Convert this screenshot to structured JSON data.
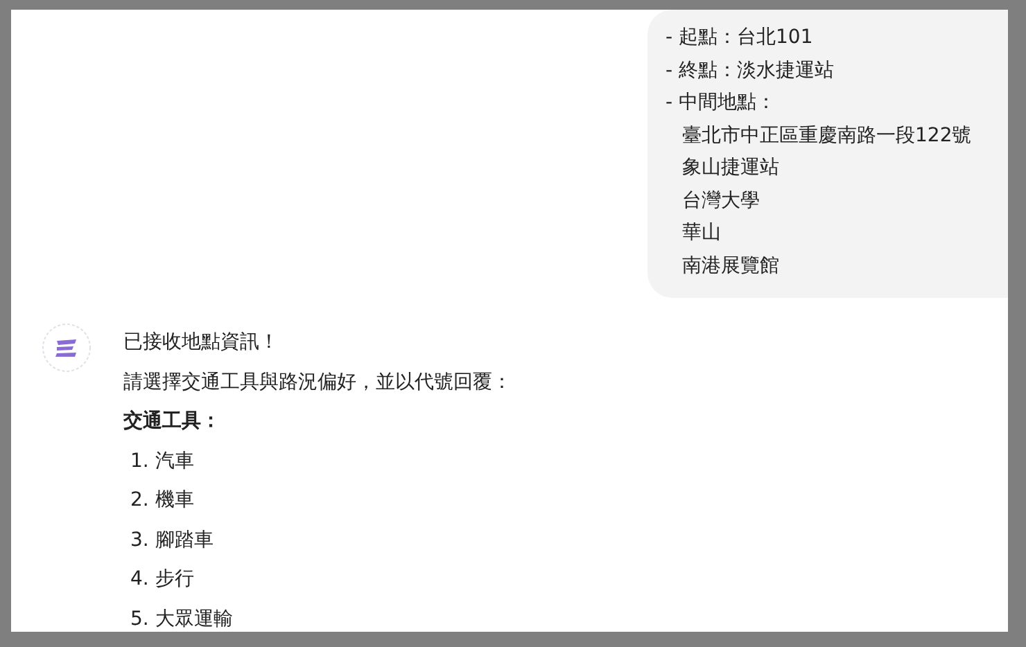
{
  "user_message": {
    "lines": [
      {
        "text": "- 起點：台北101",
        "kind": "bullet"
      },
      {
        "text": "- 終點：淡水捷運站",
        "kind": "bullet"
      },
      {
        "text": "- 中間地點：",
        "kind": "bullet"
      },
      {
        "text": "臺北市中正區重慶南路一段122號",
        "kind": "sub"
      },
      {
        "text": "象山捷運站",
        "kind": "sub"
      },
      {
        "text": "台灣大學",
        "kind": "sub"
      },
      {
        "text": "華山",
        "kind": "sub"
      },
      {
        "text": "南港展覽館",
        "kind": "sub"
      }
    ]
  },
  "assistant_message": {
    "paragraphs": [
      "已接收地點資訊！",
      "請選擇交通工具與路況偏好，並以代號回覆："
    ],
    "heading": "交通工具：",
    "options": [
      "1. 汽車",
      "2. 機車",
      "3. 腳踏車",
      "4. 步行",
      "5. 大眾運輸"
    ]
  }
}
